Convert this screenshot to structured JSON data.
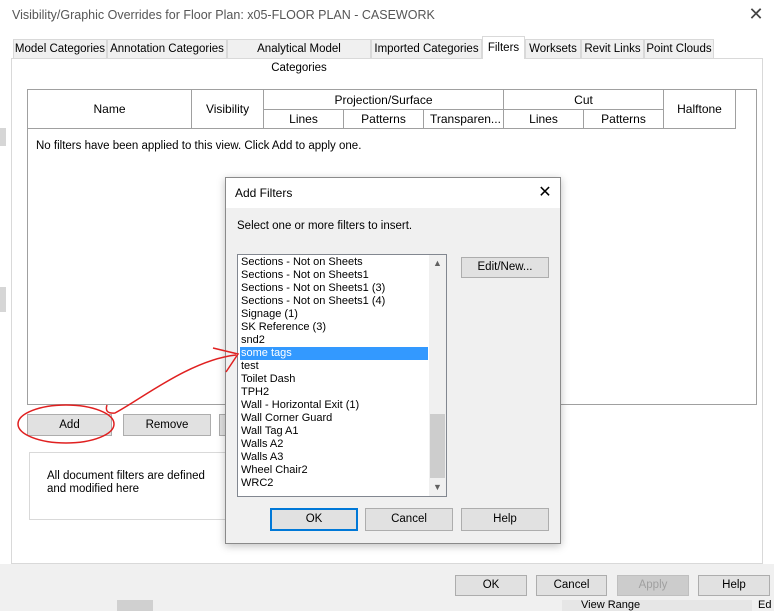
{
  "window": {
    "title": "Visibility/Graphic Overrides for Floor Plan: x05-FLOOR PLAN - CASEWORK",
    "close_glyph": "✕"
  },
  "tabs": [
    {
      "label": "Model Categories",
      "active": false
    },
    {
      "label": "Annotation Categories",
      "active": false
    },
    {
      "label": "Analytical Model Categories",
      "active": false
    },
    {
      "label": "Imported Categories",
      "active": false
    },
    {
      "label": "Filters",
      "active": true
    },
    {
      "label": "Worksets",
      "active": false
    },
    {
      "label": "Revit Links",
      "active": false
    },
    {
      "label": "Point Clouds",
      "active": false
    }
  ],
  "grid": {
    "headers": {
      "name": "Name",
      "visibility": "Visibility",
      "projection_surface": "Projection/Surface",
      "cut": "Cut",
      "halftone": "Halftone",
      "lines": "Lines",
      "patterns": "Patterns",
      "transparency": "Transparen...",
      "cut_lines": "Lines",
      "cut_patterns": "Patterns"
    },
    "empty_message": "No filters have been applied to this view. Click Add to apply one."
  },
  "filter_buttons": {
    "add": "Add",
    "remove": "Remove"
  },
  "info_text": "All document filters are defined and modified here",
  "bottom_buttons": {
    "ok": "OK",
    "cancel": "Cancel",
    "apply": "Apply",
    "help": "Help"
  },
  "background_fragments": {
    "view_range": "View Range",
    "ed": "Ed"
  },
  "dialog": {
    "title": "Add Filters",
    "close_glyph": "✕",
    "instruction": "Select one or more filters to insert.",
    "edit_new": "Edit/New...",
    "ok": "OK",
    "cancel": "Cancel",
    "help": "Help",
    "selected_item": "some tags",
    "items": [
      "Sections - Not on Sheets",
      "Sections - Not on Sheets1",
      "Sections - Not on Sheets1 (3)",
      "Sections - Not on Sheets1 (4)",
      "Signage (1)",
      "SK Reference (3)",
      "snd2",
      "some tags",
      "test",
      "Toilet Dash",
      "TPH2",
      "Wall - Horizontal Exit (1)",
      "Wall Corner Guard",
      "Wall Tag A1",
      "Walls A2",
      "Walls A3",
      "Wheel Chair2",
      "WRC2"
    ]
  },
  "colors": {
    "selection": "#3399ff",
    "focus_border": "#0078d7",
    "annotation": "#e02020"
  },
  "icons": {
    "scroll_up": "▲",
    "scroll_down": "▼"
  }
}
